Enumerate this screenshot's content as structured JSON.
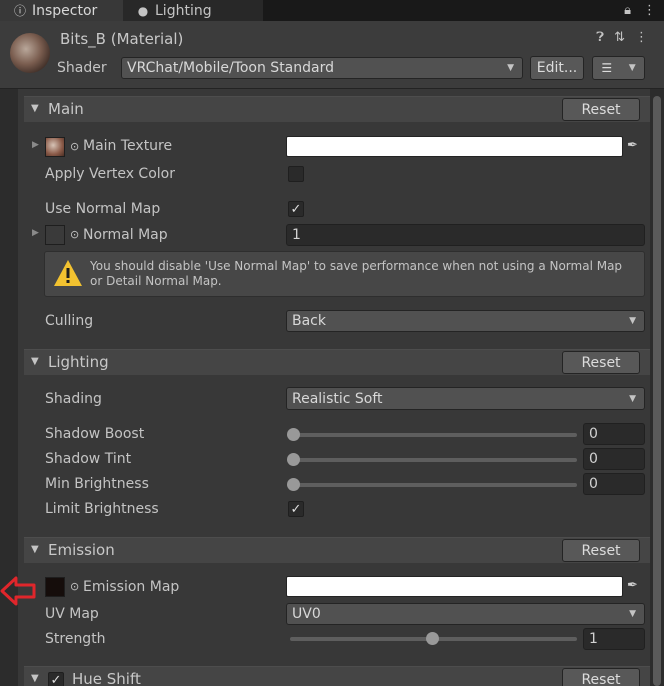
{
  "tabs": {
    "inspector_label": "Inspector",
    "lighting_label": "Lighting"
  },
  "header": {
    "material_name": "Bits_B (Material)",
    "shader_label": "Shader",
    "shader_value": "VRChat/Mobile/Toon Standard",
    "edit_label": "Edit..."
  },
  "sections": {
    "main": {
      "title": "Main",
      "reset_label": "Reset",
      "main_texture_label": "Main Texture",
      "apply_vertex_color_label": "Apply Vertex Color",
      "apply_vertex_color_checked": false,
      "use_normal_map_label": "Use Normal Map",
      "use_normal_map_checked": true,
      "normal_map_label": "Normal Map",
      "normal_map_value": "1",
      "help_text": "You should disable 'Use Normal Map' to save performance when not using a Normal Map or Detail Normal Map.",
      "culling_label": "Culling",
      "culling_value": "Back"
    },
    "lighting": {
      "title": "Lighting",
      "reset_label": "Reset",
      "shading_label": "Shading",
      "shading_value": "Realistic Soft",
      "shadow_boost_label": "Shadow Boost",
      "shadow_boost_value": "0",
      "shadow_tint_label": "Shadow Tint",
      "shadow_tint_value": "0",
      "min_brightness_label": "Min Brightness",
      "min_brightness_value": "0",
      "limit_brightness_label": "Limit Brightness",
      "limit_brightness_checked": true
    },
    "emission": {
      "title": "Emission",
      "reset_label": "Reset",
      "emission_map_label": "Emission Map",
      "uv_map_label": "UV Map",
      "uv_map_value": "UV0",
      "strength_label": "Strength",
      "strength_value": "1"
    },
    "hue_shift": {
      "title": "Hue Shift",
      "reset_label": "Reset",
      "enabled": true
    }
  },
  "colors": {
    "annotation_arrow": "#e0262b",
    "warning_icon": "#f2c230"
  }
}
